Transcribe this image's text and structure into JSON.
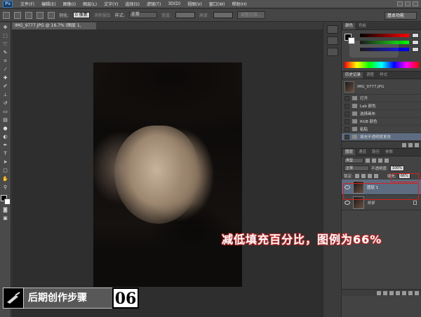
{
  "app": {
    "menu": [
      "文件(F)",
      "编辑(E)",
      "图像(I)",
      "图层(L)",
      "文字(Y)",
      "选择(S)",
      "滤镜(T)",
      "3D(D)",
      "视图(V)",
      "窗口(W)",
      "帮助(H)"
    ],
    "logo_text": "Ps"
  },
  "options_bar": {
    "feather_label": "羽化:",
    "feather_value": "0 像素",
    "anti_alias_label": "消除锯齿",
    "style_label": "样式:",
    "style_value": "正常",
    "width_label": "宽度:",
    "height_label": "高度:",
    "refine_edge_label": "调整边缘...",
    "workspace": "基本功能"
  },
  "document": {
    "tab_title": "IMG_9777.JPG @ 16.7% (图层 1, RGB/8) *"
  },
  "color_panel": {
    "tabs": [
      "颜色",
      "色板"
    ]
  },
  "history_panel": {
    "tabs": [
      "历史记录",
      "调整",
      "样式"
    ],
    "snapshot": "IMG_9777.JPG",
    "items": [
      "打开",
      "Lab 颜色",
      "选择画布",
      "RGB 颜色",
      "粘贴",
      "填充不透明度更改"
    ],
    "selected_index": 5
  },
  "layers_panel": {
    "tabs": [
      "图层",
      "通道",
      "路径",
      "参数"
    ],
    "filter_value": "类型",
    "blend_mode": "正常",
    "opacity_label": "不透明度:",
    "opacity_value": "100%",
    "lock_label": "锁定:",
    "fill_label": "填充:",
    "fill_value": "66%",
    "layers": [
      {
        "name": "图层 1",
        "active": true
      },
      {
        "name": "背景",
        "active": false
      }
    ]
  },
  "overlay": {
    "caption": "减低填充百分比，图例为66%",
    "step_title": "后期创作步骤",
    "step_number": "06"
  }
}
